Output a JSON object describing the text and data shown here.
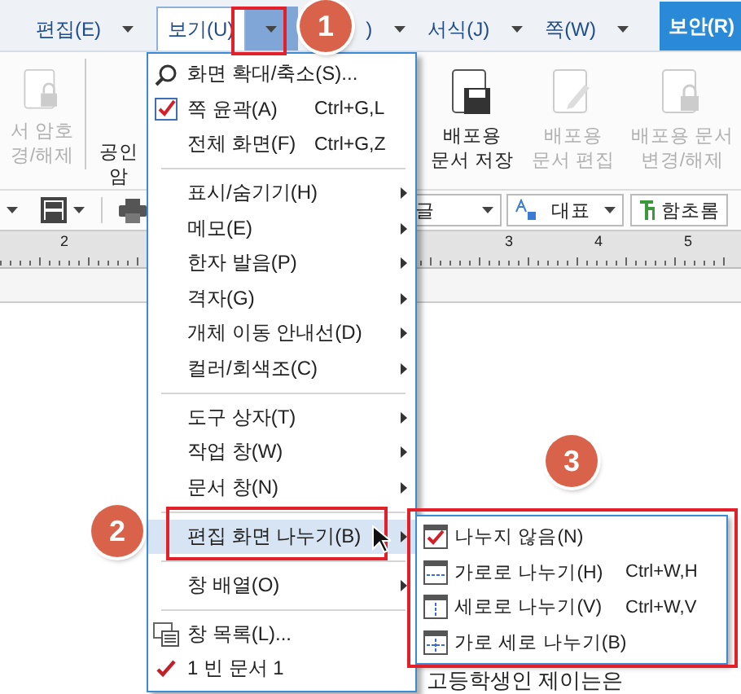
{
  "menubar": [
    {
      "label": "편집(E)",
      "kind": "menu"
    },
    {
      "label": "보기(U)",
      "kind": "open"
    },
    {
      "label": ")",
      "kind": "menu"
    },
    {
      "label": "서식(J)",
      "kind": "menu"
    },
    {
      "label": "쪽(W)",
      "kind": "menu"
    },
    {
      "label": "보안(R)",
      "kind": "tab"
    }
  ],
  "ribbon": [
    {
      "lines": [
        "서 암호",
        "경/해제"
      ],
      "kind": "lock",
      "disabled": true
    },
    {
      "lines": [
        "공인",
        "암"
      ],
      "kind": "plain",
      "disabled": false
    },
    {
      "lines": [
        "배포용",
        "문서 저장"
      ],
      "kind": "save",
      "disabled": false
    },
    {
      "lines": [
        "배포용",
        "문서 편집"
      ],
      "kind": "edit",
      "disabled": true
    },
    {
      "lines": [
        "배포용 문서",
        "변경/해제"
      ],
      "kind": "lock",
      "disabled": true
    }
  ],
  "format_bar": {
    "font_language": "글",
    "style": "대표",
    "font": "함초롬"
  },
  "ruler": [
    "2",
    "3",
    "4",
    "5"
  ],
  "document_text": "고등학생인 제이는은",
  "view_menu": [
    {
      "kind": "zoom",
      "label": "화면 확대/축소(S)...",
      "selected": false
    },
    {
      "kind": "toggle",
      "label": "쪽 윤곽(A)",
      "shortcut": "Ctrl+G,L",
      "checked": true,
      "selected": false
    },
    {
      "kind": "item",
      "label": "전체 화면(F)",
      "shortcut": "Ctrl+G,Z",
      "selected": false
    },
    {
      "kind": "separator"
    },
    {
      "kind": "submenu",
      "label": "표시/숨기기(H)",
      "selected": false
    },
    {
      "kind": "submenu",
      "label": "메모(E)",
      "selected": false
    },
    {
      "kind": "submenu",
      "label": "한자 발음(P)",
      "selected": false
    },
    {
      "kind": "submenu",
      "label": "격자(G)",
      "selected": false
    },
    {
      "kind": "submenu",
      "label": "개체 이동 안내선(D)",
      "selected": false
    },
    {
      "kind": "submenu",
      "label": "컬러/회색조(C)",
      "selected": false
    },
    {
      "kind": "separator"
    },
    {
      "kind": "submenu",
      "label": "도구 상자(T)",
      "selected": false
    },
    {
      "kind": "submenu",
      "label": "작업 창(W)",
      "selected": false
    },
    {
      "kind": "submenu",
      "label": "문서 창(N)",
      "selected": false
    },
    {
      "kind": "separator"
    },
    {
      "kind": "submenu",
      "label": "편집 화면 나누기(B)",
      "selected": true
    },
    {
      "kind": "separator"
    },
    {
      "kind": "submenu",
      "label": "창 배열(O)",
      "selected": false
    },
    {
      "kind": "separator"
    },
    {
      "kind": "window-list",
      "label": "창 목록(L)...",
      "selected": false
    },
    {
      "kind": "document",
      "label": "1 빈 문서 1",
      "checked": true,
      "selected": false
    }
  ],
  "split_menu": [
    {
      "kind": "single",
      "label": "나누지 않음(N)",
      "checked": true
    },
    {
      "kind": "horizontal",
      "label": "가로로 나누기(H)",
      "shortcut": "Ctrl+W,H",
      "checked": false
    },
    {
      "kind": "vertical",
      "label": "세로로 나누기(V)",
      "shortcut": "Ctrl+W,V",
      "checked": false
    },
    {
      "kind": "both",
      "label": "가로 세로 나누기(B)",
      "checked": false
    }
  ],
  "callouts": [
    "1",
    "2",
    "3"
  ]
}
